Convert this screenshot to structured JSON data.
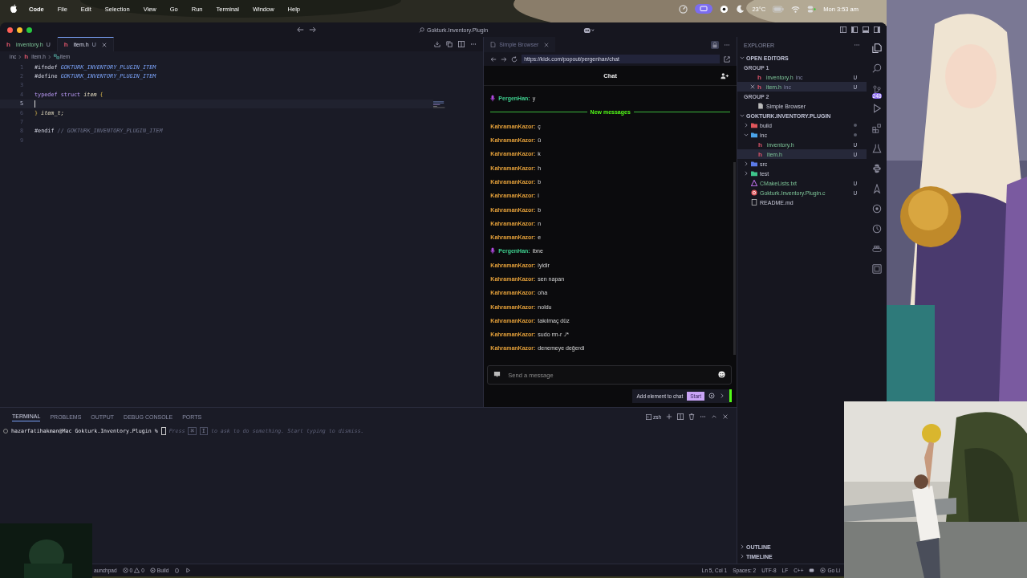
{
  "menubar": {
    "app": "Code",
    "menus": [
      "File",
      "Edit",
      "Selection",
      "View",
      "Go",
      "Run",
      "Terminal",
      "Window",
      "Help"
    ],
    "weather": "23°C",
    "clock": "Mon 3:53 am"
  },
  "window": {
    "title": "Gokturk.Inventory.Plugin"
  },
  "editor_tabs": [
    {
      "icon": "h",
      "name": "inventory.h",
      "status": "U",
      "selected": false
    },
    {
      "icon": "h",
      "name": "item.h",
      "status": "U",
      "selected": true
    }
  ],
  "breadcrumb": [
    {
      "kind": "folder",
      "text": "inc"
    },
    {
      "kind": "h",
      "icon": "h",
      "text": "item.h"
    },
    {
      "kind": "struct",
      "text": "item"
    }
  ],
  "code": [
    {
      "number": "1",
      "current": false,
      "tokens": [
        {
          "kind": "directive",
          "text": "#ifndef"
        },
        {
          "kind": "macro",
          "text": "GOKTURK_INVENTORY_PLUGIN_ITEM"
        }
      ]
    },
    {
      "number": "2",
      "current": false,
      "tokens": [
        {
          "kind": "directive",
          "text": "#define"
        },
        {
          "kind": "macro",
          "text": "GOKTURK_INVENTORY_PLUGIN_ITEM"
        }
      ]
    },
    {
      "number": "3",
      "current": false
    },
    {
      "number": "4",
      "current": false,
      "tokens": [
        {
          "kind": "keyword",
          "text": "typedef"
        },
        {
          "kind": "keyword",
          "text": "struct"
        },
        {
          "kind": "name",
          "text": "item"
        },
        {
          "kind": "brace",
          "text": "{"
        }
      ]
    },
    {
      "number": "5",
      "current": true
    },
    {
      "number": "6",
      "current": false,
      "tokens": [
        {
          "kind": "brace",
          "text": "}"
        },
        {
          "kind": "name",
          "text": "item_t;"
        }
      ]
    },
    {
      "number": "7",
      "current": false
    },
    {
      "number": "8",
      "current": false,
      "tokens": [
        {
          "kind": "directive",
          "text": "#endif"
        },
        {
          "kind": "comment",
          "text": "// GOKTURK_INVENTORY_PLUGIN_ITEM"
        }
      ]
    },
    {
      "number": "9",
      "current": false
    }
  ],
  "browser": {
    "tab": "Simple Browser",
    "url": "https://kick.com/popout/pergenhan/chat"
  },
  "chat": {
    "title": "Chat",
    "messages": [
      {
        "kind": "message",
        "user": "PergenHan:",
        "text": "y",
        "color": "#3ecf8e",
        "badge": true
      },
      {
        "kind": "divider",
        "text": "New messages"
      },
      {
        "kind": "message",
        "user": "KahramanKazor:",
        "text": "ç",
        "color": "#e5a13a",
        "badge": false
      },
      {
        "kind": "message",
        "user": "KahramanKazor:",
        "text": "ü",
        "color": "#e5a13a",
        "badge": false
      },
      {
        "kind": "message",
        "user": "KahramanKazor:",
        "text": "k",
        "color": "#e5a13a",
        "badge": false
      },
      {
        "kind": "message",
        "user": "KahramanKazor:",
        "text": "h",
        "color": "#e5a13a",
        "badge": false
      },
      {
        "kind": "message",
        "user": "KahramanKazor:",
        "text": "b",
        "color": "#e5a13a",
        "badge": false
      },
      {
        "kind": "message",
        "user": "KahramanKazor:",
        "text": "i",
        "color": "#e5a13a",
        "badge": false
      },
      {
        "kind": "message",
        "user": "KahramanKazor:",
        "text": "b",
        "color": "#e5a13a",
        "badge": false
      },
      {
        "kind": "message",
        "user": "KahramanKazor:",
        "text": "n",
        "color": "#e5a13a",
        "badge": false
      },
      {
        "kind": "message",
        "user": "KahramanKazor:",
        "text": "e",
        "color": "#e5a13a",
        "badge": false
      },
      {
        "kind": "message",
        "user": "PergenHan:",
        "text": "ibne",
        "color": "#3ecf8e",
        "badge": true
      },
      {
        "kind": "message",
        "user": "KahramanKazor:",
        "text": "iyidir",
        "color": "#e5a13a",
        "badge": false
      },
      {
        "kind": "message",
        "user": "KahramanKazor:",
        "text": "sen napan",
        "color": "#e5a13a",
        "badge": false
      },
      {
        "kind": "message",
        "user": "KahramanKazor:",
        "text": "oha",
        "color": "#e5a13a",
        "badge": false
      },
      {
        "kind": "message",
        "user": "KahramanKazor:",
        "text": "noldu",
        "color": "#e5a13a",
        "badge": false
      },
      {
        "kind": "message",
        "user": "KahramanKazor:",
        "text": "takılmaç düz",
        "color": "#e5a13a",
        "badge": false
      },
      {
        "kind": "message",
        "user": "KahramanKazor:",
        "text": "sudo rm-r ./*",
        "color": "#e5a13a",
        "badge": false
      },
      {
        "kind": "message",
        "user": "KahramanKazor:",
        "text": "denemeye değerdi",
        "color": "#e5a13a",
        "badge": false
      }
    ],
    "input": {
      "placeholder": "Send a message"
    },
    "tool": {
      "label": "Add element to chat",
      "button": "Start"
    }
  },
  "explorer": {
    "title": "EXPLORER",
    "open_editors": {
      "label": "OPEN EDITORS",
      "expanded": true,
      "groups": [
        {
          "label": "GROUP 1",
          "files": [
            {
              "kind": "h",
              "icon": "h",
              "name": "inventory.h",
              "folder": "inc",
              "status": "U",
              "selected": false
            },
            {
              "kind": "h",
              "icon": "h",
              "name": "item.h",
              "folder": "inc",
              "status": "U",
              "selected": true
            }
          ]
        },
        {
          "label": "GROUP 2",
          "files": [
            {
              "kind": "browser",
              "name": "Simple Browser",
              "selected": false
            }
          ]
        }
      ]
    },
    "project": {
      "label": "GOKTURK.INVENTORY.PLUGIN",
      "expanded": true,
      "items": [
        {
          "kind": "folder",
          "name": "build",
          "color": "#e0565b",
          "expanded": false,
          "dot": true,
          "selected": false
        },
        {
          "kind": "folder",
          "name": "inc",
          "color": "#4aa3e8",
          "expanded": true,
          "dot": true,
          "selected": false,
          "children": [
            {
              "kind": "h",
              "icon": "h",
              "name": "inventory.h",
              "status": "U",
              "selected": false
            },
            {
              "kind": "h",
              "icon": "h",
              "name": "item.h",
              "status": "U",
              "selected": true
            }
          ]
        },
        {
          "kind": "folder",
          "name": "src",
          "color": "#5b7be8",
          "expanded": false,
          "dot": false,
          "selected": false
        },
        {
          "kind": "folder",
          "name": "test",
          "color": "#3ec48a",
          "expanded": false,
          "dot": false,
          "selected": false
        },
        {
          "kind": "cmake",
          "name": "CMakeLists.txt",
          "status": "U",
          "selected": false
        },
        {
          "kind": "c",
          "name": "Gokturk.Inventory.Plugin.c",
          "status": "U",
          "selected": false
        },
        {
          "kind": "md",
          "name": "README.md",
          "selected": false
        }
      ]
    },
    "sections": [
      {
        "label": "OUTLINE",
        "expanded": false
      },
      {
        "label": "TIMELINE",
        "expanded": false
      }
    ]
  },
  "activity": {
    "badge": "248"
  },
  "terminal": {
    "tabs": [
      {
        "label": "TERMINAL",
        "selected": true
      },
      {
        "label": "PROBLEMS",
        "selected": false
      },
      {
        "label": "OUTPUT",
        "selected": false
      },
      {
        "label": "DEBUG CONSOLE",
        "selected": false
      },
      {
        "label": "PORTS",
        "selected": false
      }
    ],
    "shell": "zsh",
    "prompt": "hazarfatihakman@Mac Gokturk.Inventory.Plugin %",
    "hint_before": "Press",
    "keys": [
      "⌘",
      "I"
    ],
    "hint_after": "to ask to do something. Start typing to dismiss."
  },
  "status_bar": {
    "branch": "aunchpad",
    "errors": "0",
    "warnings": "0",
    "task": "Build",
    "right": [
      "Ln 5, Col 1",
      "Spaces: 2",
      "UTF-8",
      "LF",
      "C++"
    ],
    "live": "Go Li"
  }
}
